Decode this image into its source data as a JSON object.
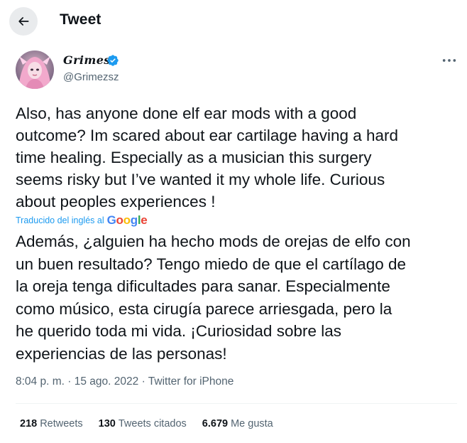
{
  "header": {
    "title": "Tweet"
  },
  "tweet": {
    "author": {
      "display_name": "Grimes",
      "handle": "@Grimezsz",
      "verified": true
    },
    "text": "Also, has anyone done elf ear mods with a good\noutcome?  Im scared about ear cartilage having a hard\ntime healing.  Especially as a musician this surgery\nseems risky but I’ve wanted it my whole life.  Curious\nabout peoples experiences !",
    "translation": {
      "label": "Traducido del inglés al",
      "provider": "Google",
      "text": "Además, ¿alguien ha hecho mods de orejas de elfo con\nun buen resultado? Tengo miedo de que el cartílago de\nla oreja tenga dificultades para sanar. Especialmente\ncomo músico, esta cirugía parece arriesgada, pero la\nhe querido toda mi vida. ¡Curiosidad sobre las\nexperiencias de las personas!"
    },
    "time": "8:04 p. m.",
    "separator": "·",
    "date": "15 ago. 2022",
    "source": "Twitter for iPhone",
    "stats": {
      "retweets_count": "218",
      "retweets_label": "Retweets",
      "quotes_count": "130",
      "quotes_label": "Tweets citados",
      "likes_count": "6.679",
      "likes_label": "Me gusta"
    }
  },
  "colors": {
    "accent": "#1d9bf0",
    "text_primary": "#0f1419",
    "text_secondary": "#536471",
    "back_button_bg": "#e9ebed",
    "google_blue": "#4285f4",
    "google_red": "#ea4335",
    "google_yellow": "#fbbc05",
    "google_green": "#34a853"
  },
  "icons": {
    "back": "arrow-left-icon",
    "verified": "verified-badge-icon",
    "more": "more-horizontal-icon"
  }
}
